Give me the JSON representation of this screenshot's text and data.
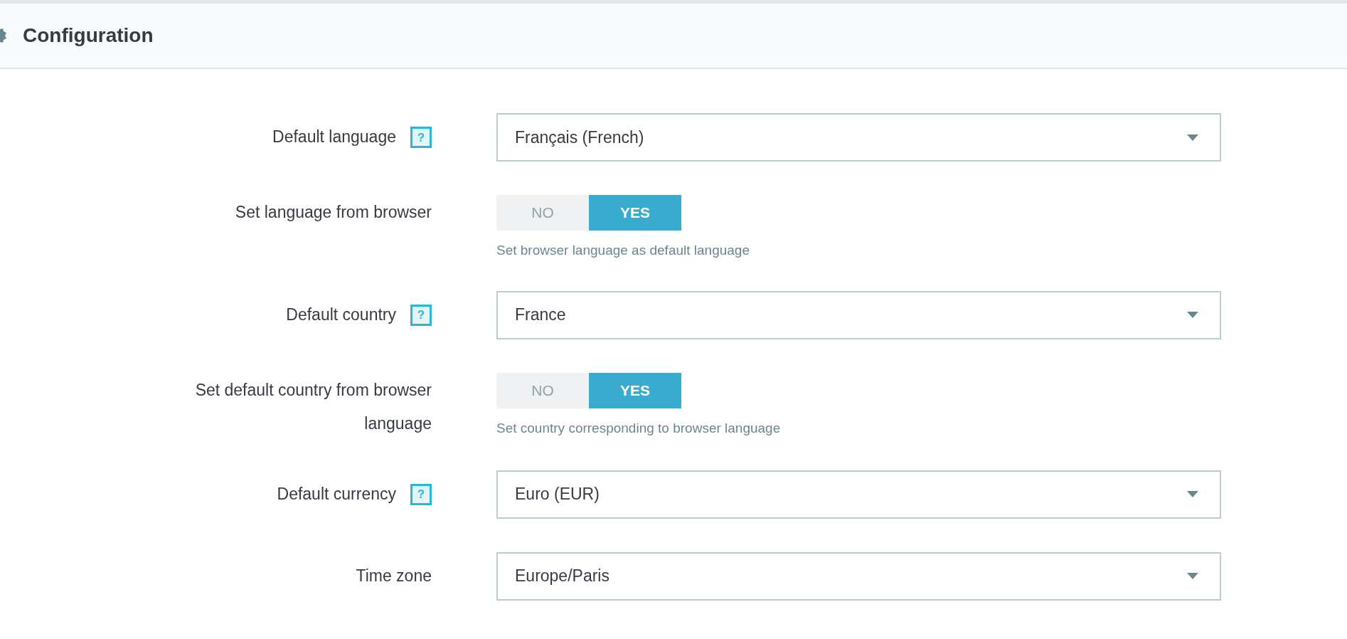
{
  "panel": {
    "title": "Configuration"
  },
  "fields": [
    {
      "kind": "select",
      "label": "Default language",
      "help": "?",
      "value": "Français (French)"
    },
    {
      "kind": "toggle",
      "label": "Set language from browser",
      "options": [
        {
          "label": "NO",
          "selected": false
        },
        {
          "label": "YES",
          "selected": true
        }
      ],
      "help_text": "Set browser language as default language"
    },
    {
      "kind": "select",
      "label": "Default country",
      "help": "?",
      "value": "France"
    },
    {
      "kind": "toggle",
      "label": "Set default country from browser language",
      "options": [
        {
          "label": "NO",
          "selected": false
        },
        {
          "label": "YES",
          "selected": true
        }
      ],
      "help_text": "Set country corresponding to browser language"
    },
    {
      "kind": "select",
      "label": "Default currency",
      "help": "?",
      "value": "Euro (EUR)"
    },
    {
      "kind": "select",
      "label": "Time zone",
      "value": "Europe/Paris"
    }
  ]
}
